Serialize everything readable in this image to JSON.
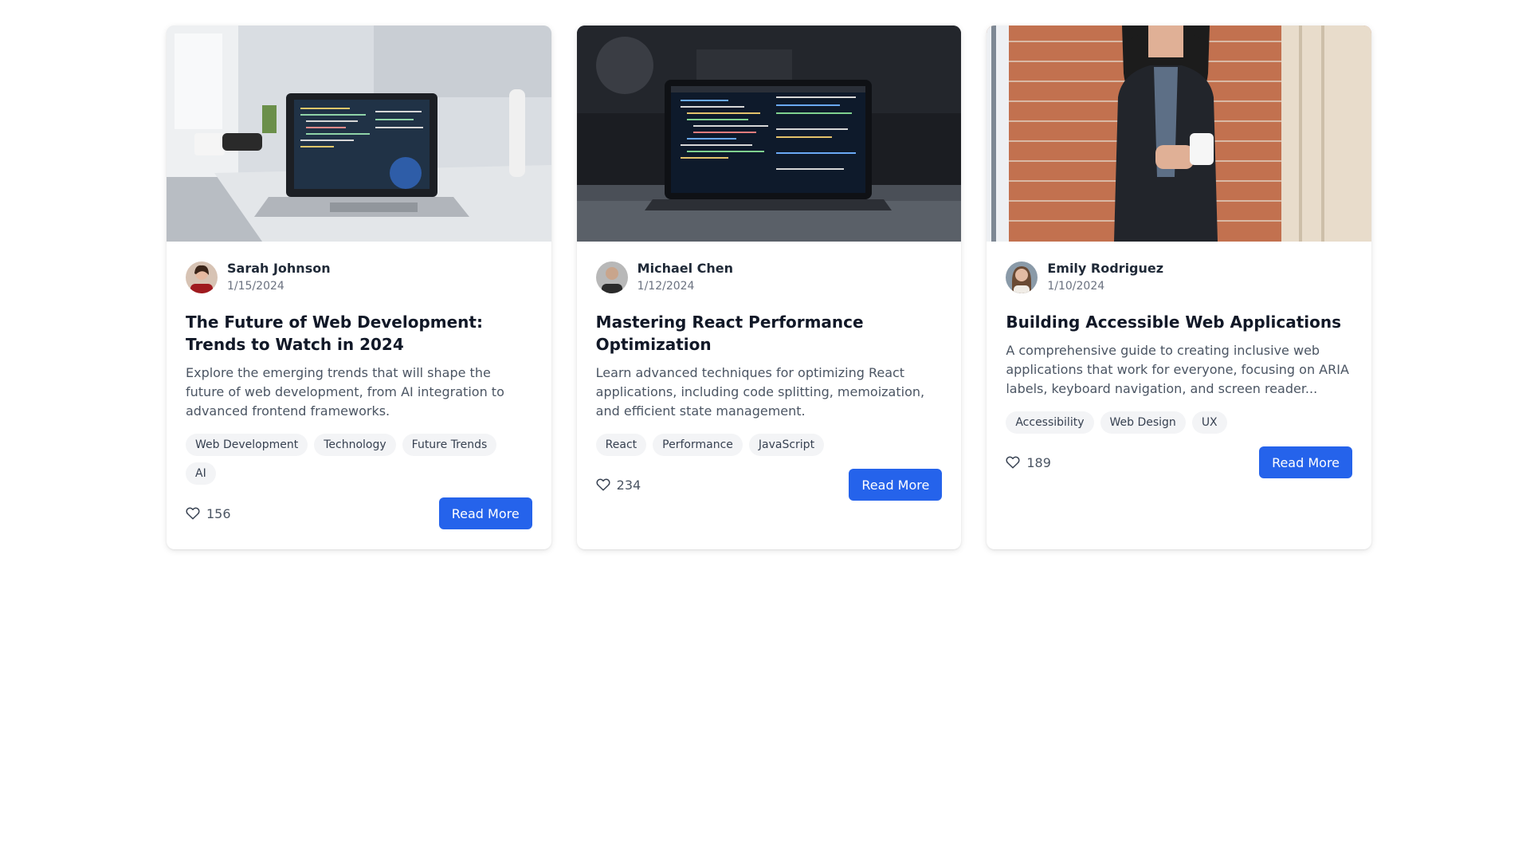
{
  "cards": [
    {
      "author": "Sarah Johnson",
      "date": "1/15/2024",
      "title": "The Future of Web Development: Trends to Watch in 2024",
      "excerpt": "Explore the emerging trends that will shape the future of web development, from AI integration to advanced frontend frameworks.",
      "tags": [
        "Web Development",
        "Technology",
        "Future Trends",
        "AI"
      ],
      "likes": "156",
      "button_label": "Read More"
    },
    {
      "author": "Michael Chen",
      "date": "1/12/2024",
      "title": "Mastering React Performance Optimization",
      "excerpt": "Learn advanced techniques for optimizing React applications, including code splitting, memoization, and efficient state management.",
      "tags": [
        "React",
        "Performance",
        "JavaScript"
      ],
      "likes": "234",
      "button_label": "Read More"
    },
    {
      "author": "Emily Rodriguez",
      "date": "1/10/2024",
      "title": "Building Accessible Web Applications",
      "excerpt": "A comprehensive guide to creating inclusive web applications that work for everyone, focusing on ARIA labels, keyboard navigation, and screen reader...",
      "tags": [
        "Accessibility",
        "Web Design",
        "UX"
      ],
      "likes": "189",
      "button_label": "Read More"
    }
  ],
  "icons": {
    "like": "heart-icon"
  },
  "colors": {
    "accent": "#2563eb",
    "tag_bg": "#f3f4f6"
  }
}
